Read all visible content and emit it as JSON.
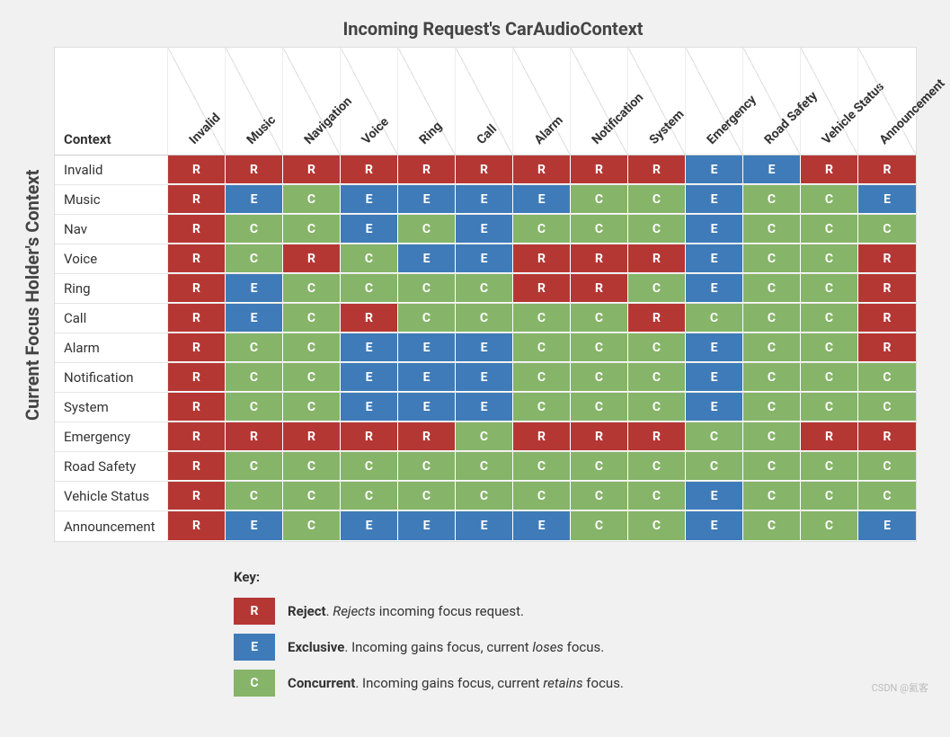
{
  "titles": {
    "top": "Incoming Request's CarAudioContext",
    "side": "Current Focus Holder's Context",
    "corner": "Context"
  },
  "columns": [
    "Invalid",
    "Music",
    "Navigation",
    "Voice",
    "Ring",
    "Call",
    "Alarm",
    "Notification",
    "System",
    "Emergency",
    "Road Safety",
    "Vehicle Status",
    "Announcement"
  ],
  "rows": [
    {
      "label": "Invalid",
      "cells": [
        "R",
        "R",
        "R",
        "R",
        "R",
        "R",
        "R",
        "R",
        "R",
        "E",
        "E",
        "R",
        "R"
      ]
    },
    {
      "label": "Music",
      "cells": [
        "R",
        "E",
        "C",
        "E",
        "E",
        "E",
        "E",
        "C",
        "C",
        "E",
        "C",
        "C",
        "E"
      ]
    },
    {
      "label": "Nav",
      "cells": [
        "R",
        "C",
        "C",
        "E",
        "C",
        "E",
        "C",
        "C",
        "C",
        "E",
        "C",
        "C",
        "C"
      ]
    },
    {
      "label": "Voice",
      "cells": [
        "R",
        "C",
        "R",
        "C",
        "E",
        "E",
        "R",
        "R",
        "R",
        "E",
        "C",
        "C",
        "R"
      ]
    },
    {
      "label": "Ring",
      "cells": [
        "R",
        "E",
        "C",
        "C",
        "C",
        "C",
        "R",
        "R",
        "C",
        "E",
        "C",
        "C",
        "R"
      ]
    },
    {
      "label": "Call",
      "cells": [
        "R",
        "E",
        "C",
        "R",
        "C",
        "C",
        "C",
        "C",
        "R",
        "C",
        "C",
        "C",
        "R"
      ]
    },
    {
      "label": "Alarm",
      "cells": [
        "R",
        "C",
        "C",
        "E",
        "E",
        "E",
        "C",
        "C",
        "C",
        "E",
        "C",
        "C",
        "R"
      ]
    },
    {
      "label": "Notification",
      "cells": [
        "R",
        "C",
        "C",
        "E",
        "E",
        "E",
        "C",
        "C",
        "C",
        "E",
        "C",
        "C",
        "C"
      ]
    },
    {
      "label": "System",
      "cells": [
        "R",
        "C",
        "C",
        "E",
        "E",
        "E",
        "C",
        "C",
        "C",
        "E",
        "C",
        "C",
        "C"
      ]
    },
    {
      "label": "Emergency",
      "cells": [
        "R",
        "R",
        "R",
        "R",
        "R",
        "C",
        "R",
        "R",
        "R",
        "C",
        "C",
        "R",
        "R"
      ]
    },
    {
      "label": "Road Safety",
      "cells": [
        "R",
        "C",
        "C",
        "C",
        "C",
        "C",
        "C",
        "C",
        "C",
        "C",
        "C",
        "C",
        "C"
      ]
    },
    {
      "label": "Vehicle Status",
      "cells": [
        "R",
        "C",
        "C",
        "C",
        "C",
        "C",
        "C",
        "C",
        "C",
        "E",
        "C",
        "C",
        "C"
      ]
    },
    {
      "label": "Announcement",
      "cells": [
        "R",
        "E",
        "C",
        "E",
        "E",
        "E",
        "E",
        "C",
        "C",
        "E",
        "C",
        "C",
        "E"
      ]
    }
  ],
  "legend": {
    "title": "Key:",
    "items": [
      {
        "code": "R",
        "name": "Reject",
        "desc_before": ". ",
        "desc_italic": "Rejects",
        "desc_after": " incoming focus request."
      },
      {
        "code": "E",
        "name": "Exclusive",
        "desc_before": ". Incoming gains focus, current ",
        "desc_italic": "loses",
        "desc_after": " focus."
      },
      {
        "code": "C",
        "name": "Concurrent",
        "desc_before": ". Incoming gains focus, current ",
        "desc_italic": "retains",
        "desc_after": " focus."
      }
    ]
  },
  "watermark": "CSDN @氦客",
  "colors": {
    "R": "#b53734",
    "E": "#3f7bb8",
    "C": "#86b469"
  }
}
